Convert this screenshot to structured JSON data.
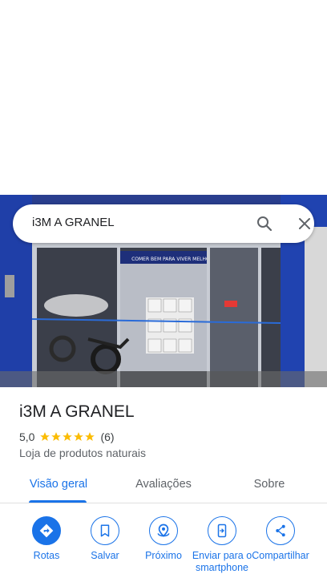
{
  "search": {
    "query": "i3M A GRANEL"
  },
  "photo": {
    "sign_text": "COMER BEM PARA VIVER MELHOR"
  },
  "place": {
    "name": "i3M A GRANEL",
    "rating": "5,0",
    "stars": 5,
    "review_count": "(6)",
    "category": "Loja de produtos naturais"
  },
  "tabs": [
    {
      "label": "Visão geral",
      "active": true
    },
    {
      "label": "Avaliações",
      "active": false
    },
    {
      "label": "Sobre",
      "active": false
    }
  ],
  "actions": [
    {
      "label": "Rotas",
      "icon": "directions-icon"
    },
    {
      "label": "Salvar",
      "icon": "bookmark-icon"
    },
    {
      "label": "Próximo",
      "icon": "nearby-icon"
    },
    {
      "label": "Enviar para o smartphone",
      "icon": "send-to-phone-icon"
    },
    {
      "label": "Compartilhar",
      "icon": "share-icon"
    }
  ],
  "colors": {
    "accent": "#1a73e8",
    "star": "#fbbc04"
  }
}
